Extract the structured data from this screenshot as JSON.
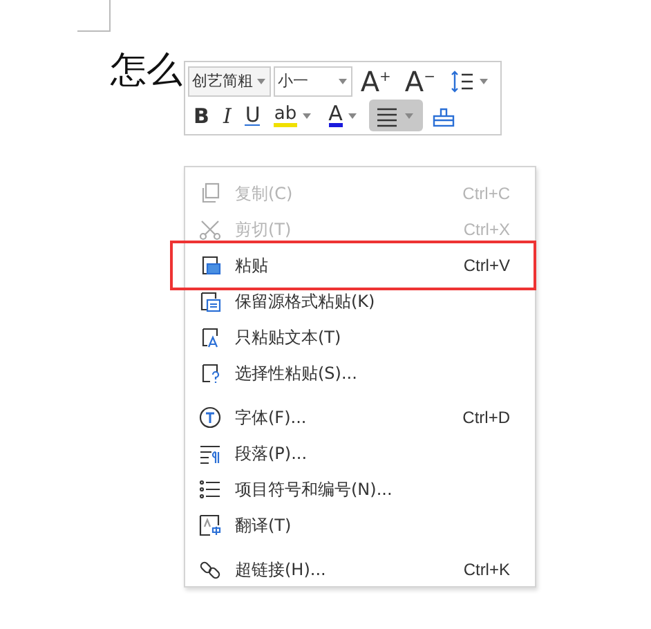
{
  "document": {
    "heading": "怎么"
  },
  "mini_toolbar": {
    "font_name": "创艺简粗",
    "font_size": "小一",
    "row_1": [
      {
        "kind": "grow",
        "label": "A",
        "superscript": "+",
        "dropdown": false
      },
      {
        "kind": "shrink",
        "label": "A",
        "superscript": "−",
        "dropdown": false
      },
      {
        "kind": "spacing",
        "dropdown": true
      }
    ],
    "row_2": [
      {
        "kind": "bold",
        "label": "B",
        "selected": false,
        "dropdown": false
      },
      {
        "kind": "italic",
        "label": "I",
        "selected": false,
        "dropdown": false
      },
      {
        "kind": "underline",
        "label": "U",
        "selected": false,
        "dropdown": false
      },
      {
        "kind": "highlight",
        "label": "ab",
        "selected": false,
        "dropdown": true
      },
      {
        "kind": "color",
        "label": "A",
        "selected": false,
        "dropdown": true
      },
      {
        "kind": "align",
        "selected": true,
        "dropdown": true
      },
      {
        "kind": "painter",
        "selected": false,
        "dropdown": false
      }
    ]
  },
  "context_menu": [
    {
      "kind": "item",
      "label": "复制(C)",
      "shortcut": "Ctrl+C",
      "disabled": true,
      "highlighted": false
    },
    {
      "kind": "item",
      "label": "剪切(T)",
      "shortcut": "Ctrl+X",
      "disabled": true,
      "highlighted": false
    },
    {
      "kind": "item",
      "label": "粘贴",
      "shortcut": "Ctrl+V",
      "disabled": false,
      "highlighted": true
    },
    {
      "kind": "item",
      "label": "保留源格式粘贴(K)",
      "disabled": false,
      "highlighted": false
    },
    {
      "kind": "item",
      "label": "只粘贴文本(T)",
      "disabled": false,
      "highlighted": false
    },
    {
      "kind": "item",
      "label": "选择性粘贴(S)...",
      "disabled": false,
      "highlighted": false
    },
    {
      "kind": "separator"
    },
    {
      "kind": "item",
      "label": "字体(F)...",
      "shortcut": "Ctrl+D",
      "disabled": false,
      "highlighted": false
    },
    {
      "kind": "item",
      "label": "段落(P)...",
      "disabled": false,
      "highlighted": false
    },
    {
      "kind": "item",
      "label": "项目符号和编号(N)...",
      "disabled": false,
      "highlighted": false
    },
    {
      "kind": "item",
      "label": "翻译(T)",
      "disabled": false,
      "highlighted": false
    },
    {
      "kind": "separator"
    },
    {
      "kind": "item",
      "label": "超链接(H)...",
      "shortcut": "Ctrl+K",
      "disabled": false,
      "highlighted": false
    }
  ]
}
